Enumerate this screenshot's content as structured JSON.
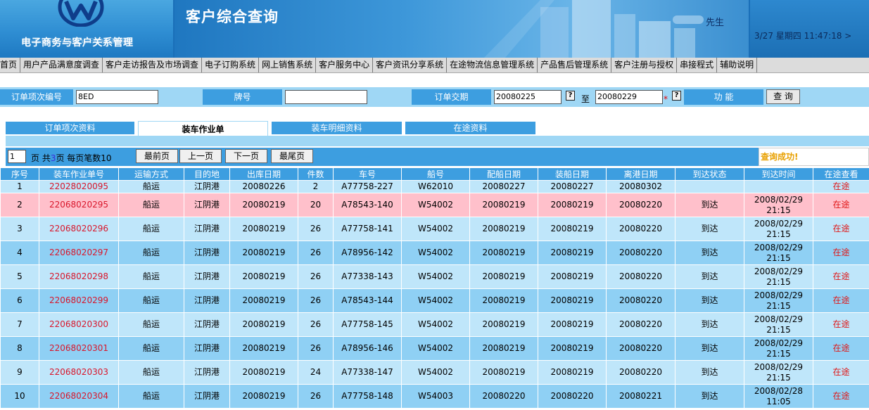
{
  "header": {
    "system_title": "电子商务与客户关系管理",
    "page_title": "客户综合查询",
    "user_suffix": "先生",
    "datetime": "3/27 星期四 11:47:18 >",
    "colors": {
      "primary": "#3d9ee0",
      "light": "#9fd7f5",
      "link": "#d9162b",
      "pink_row": "#ffc0cb"
    }
  },
  "menu": {
    "items": [
      {
        "label": "首页"
      },
      {
        "label": "用户产品满意度调查"
      },
      {
        "label": "客户走访报告及市场调查"
      },
      {
        "label": "电子订购系统"
      },
      {
        "label": "网上销售系统"
      },
      {
        "label": "客户服务中心"
      },
      {
        "label": "客户资讯分享系统"
      },
      {
        "label": "在途物流信息管理系统"
      },
      {
        "label": "产品售后管理系统"
      },
      {
        "label": "客户注册与授权"
      },
      {
        "label": "串接程式"
      },
      {
        "label": "辅助说明"
      }
    ]
  },
  "search": {
    "order_no_label": "订单项次编号",
    "order_no_value": "8ED",
    "brand_label": "牌号",
    "brand_value": "",
    "date_label": "订单交期",
    "date_from": "20080225",
    "to_label": "至",
    "date_to": "20080229",
    "required_mark": "*",
    "help_icon_glyph": "?",
    "function_label": "功  能",
    "query_button": "查 询"
  },
  "tabs": [
    {
      "label": "订单项次资料",
      "active": false
    },
    {
      "label": "装车作业单",
      "active": true
    },
    {
      "label": "装车明细资料",
      "active": false
    },
    {
      "label": "在途资料",
      "active": false
    }
  ],
  "pager": {
    "current_page": "1",
    "text_before": "页 共",
    "total_pages": "3",
    "text_after": "页 每页笔数10",
    "first": "最前页",
    "prev": "上一页",
    "next": "下一页",
    "last": "最尾页",
    "status": "查询成功!"
  },
  "table": {
    "columns": [
      "序号",
      "装车作业单号",
      "运输方式",
      "目的地",
      "出库日期",
      "件数",
      "车号",
      "船号",
      "配船日期",
      "装船日期",
      "离港日期",
      "到达状态",
      "到达时间",
      "在途查看"
    ],
    "rows": [
      [
        "1",
        "22028020095",
        "船运",
        "江阴港",
        "20080226",
        "2",
        "A77758-227",
        "W62010",
        "20080227",
        "20080227",
        "20080302",
        "",
        "",
        "在途"
      ],
      [
        "2",
        "22068020295",
        "船运",
        "江阴港",
        "20080219",
        "20",
        "A78543-140",
        "W54002",
        "20080219",
        "20080219",
        "20080220",
        "到达",
        "2008/02/29 21:15",
        "在途"
      ],
      [
        "3",
        "22068020296",
        "船运",
        "江阴港",
        "20080219",
        "26",
        "A77758-141",
        "W54002",
        "20080219",
        "20080219",
        "20080220",
        "到达",
        "2008/02/29 21:15",
        "在途"
      ],
      [
        "4",
        "22068020297",
        "船运",
        "江阴港",
        "20080219",
        "26",
        "A78956-142",
        "W54002",
        "20080219",
        "20080219",
        "20080220",
        "到达",
        "2008/02/29 21:15",
        "在途"
      ],
      [
        "5",
        "22068020298",
        "船运",
        "江阴港",
        "20080219",
        "26",
        "A77338-143",
        "W54002",
        "20080219",
        "20080219",
        "20080220",
        "到达",
        "2008/02/29 21:15",
        "在途"
      ],
      [
        "6",
        "22068020299",
        "船运",
        "江阴港",
        "20080219",
        "26",
        "A78543-144",
        "W54002",
        "20080219",
        "20080219",
        "20080220",
        "到达",
        "2008/02/29 21:15",
        "在途"
      ],
      [
        "7",
        "22068020300",
        "船运",
        "江阴港",
        "20080219",
        "26",
        "A77758-145",
        "W54002",
        "20080219",
        "20080219",
        "20080220",
        "到达",
        "2008/02/29 21:15",
        "在途"
      ],
      [
        "8",
        "22068020301",
        "船运",
        "江阴港",
        "20080219",
        "26",
        "A78956-146",
        "W54002",
        "20080219",
        "20080219",
        "20080220",
        "到达",
        "2008/02/29 21:15",
        "在途"
      ],
      [
        "9",
        "22068020303",
        "船运",
        "江阴港",
        "20080219",
        "24",
        "A77338-147",
        "W54002",
        "20080219",
        "20080219",
        "20080220",
        "到达",
        "2008/02/29 21:15",
        "在途"
      ],
      [
        "10",
        "22068020304",
        "船运",
        "江阴港",
        "20080219",
        "26",
        "A77758-148",
        "W54003",
        "20080220",
        "20080220",
        "20080221",
        "到达",
        "2008/02/28 11:05",
        "在途"
      ]
    ]
  }
}
